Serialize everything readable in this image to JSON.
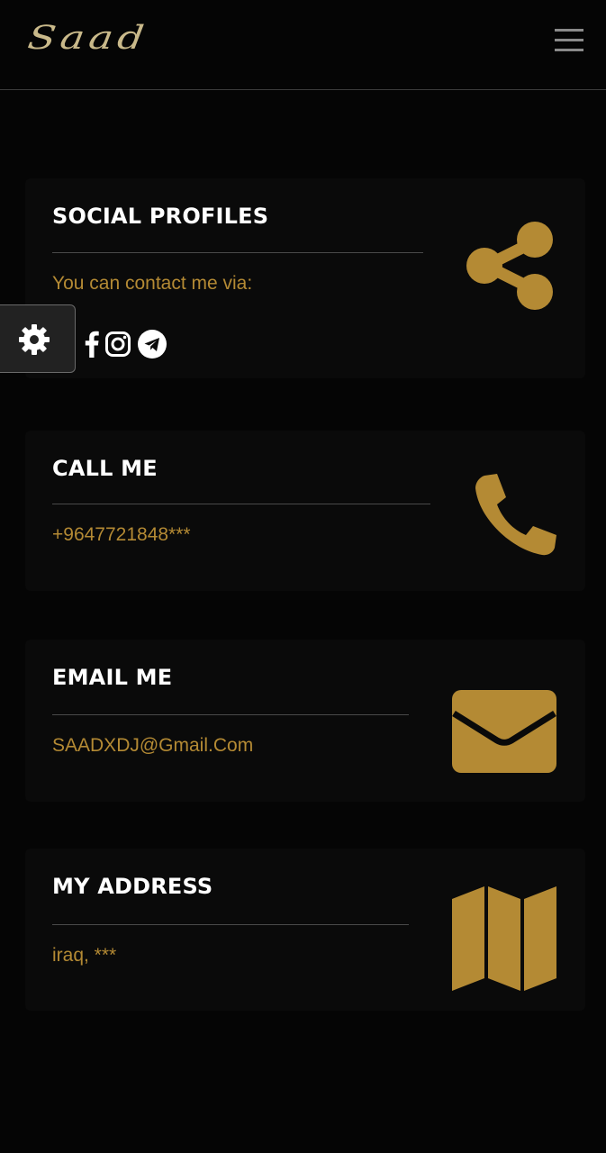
{
  "header": {
    "logo_text": "Saad",
    "menu_icon": "hamburger-menu-icon"
  },
  "settings": {
    "icon": "gear-icon"
  },
  "cards": [
    {
      "title": "SOCIAL PROFILES",
      "text": "You can contact me via:",
      "icon": "share-icon",
      "social_links": [
        "facebook-icon",
        "instagram-icon",
        "telegram-icon"
      ]
    },
    {
      "title": "CALL ME",
      "text": "+9647721848***",
      "icon": "phone-icon"
    },
    {
      "title": "EMAIL ME",
      "text": "SAADXDJ@Gmail.Com",
      "icon": "envelope-icon"
    },
    {
      "title": "MY ADDRESS",
      "text": "iraq, ***",
      "icon": "map-icon"
    }
  ],
  "colors": {
    "background": "#050505",
    "card": "#0a0a0a",
    "accent": "#b48a34",
    "title": "#ffffff",
    "logo": "#c9b98a"
  }
}
